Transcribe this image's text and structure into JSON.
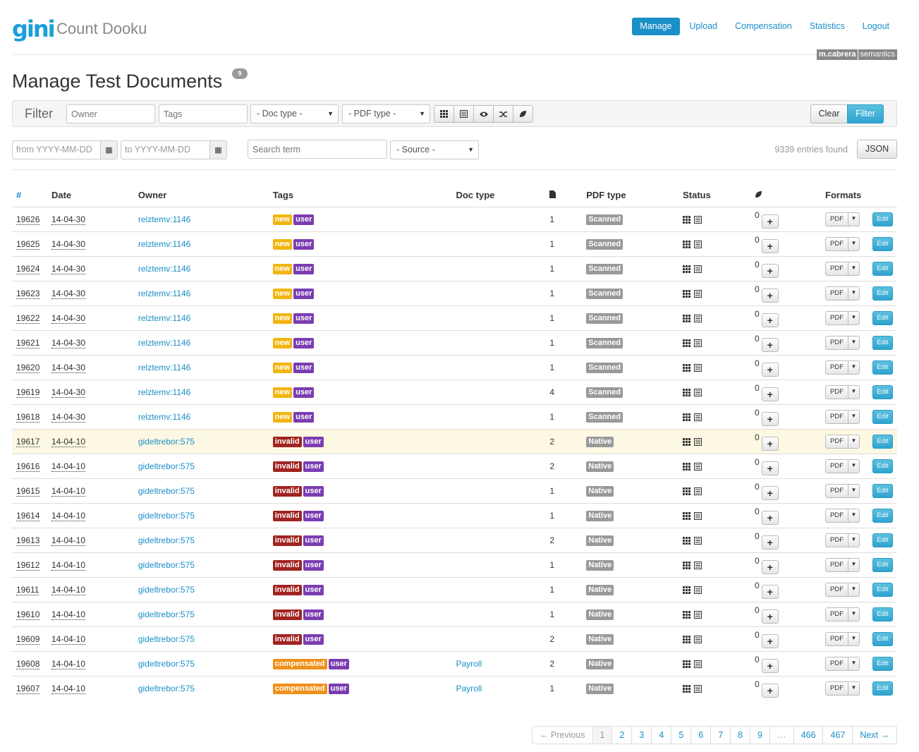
{
  "header": {
    "logo": "gini",
    "app_name": "Count Dooku",
    "nav": [
      "Manage",
      "Upload",
      "Compensation",
      "Statistics",
      "Logout"
    ],
    "user_badge": {
      "user": "m.cabrera",
      "org": "semantics"
    }
  },
  "page": {
    "title": "Manage Test Documents",
    "badge": "9"
  },
  "filter": {
    "label": "Filter",
    "owner_placeholder": "Owner",
    "tags_placeholder": "Tags",
    "doc_type": "- Doc type -",
    "pdf_type": "- PDF type -",
    "clear_label": "Clear",
    "filter_label": "Filter",
    "from_placeholder": "from YYYY-MM-DD",
    "to_placeholder": "to YYYY-MM-DD",
    "search_placeholder": "Search term",
    "source": "- Source -",
    "entries_found": "9339 entries found",
    "json_label": "JSON"
  },
  "table": {
    "headers": {
      "num": "#",
      "date": "Date",
      "owner": "Owner",
      "tags": "Tags",
      "doctype": "Doc type",
      "pdf_type": "PDF type",
      "status": "Status",
      "formats": "Formats"
    },
    "rows": [
      {
        "id": "19626",
        "date": "14-04-30",
        "owner": "relztemv:1146",
        "tags": [
          "new",
          "user"
        ],
        "doctype": "",
        "pages": "1",
        "pdf_type": "Scanned",
        "count": "0",
        "format": "PDF",
        "edit": "Edit",
        "warn": false
      },
      {
        "id": "19625",
        "date": "14-04-30",
        "owner": "relztemv:1146",
        "tags": [
          "new",
          "user"
        ],
        "doctype": "",
        "pages": "1",
        "pdf_type": "Scanned",
        "count": "0",
        "format": "PDF",
        "edit": "Edit",
        "warn": false
      },
      {
        "id": "19624",
        "date": "14-04-30",
        "owner": "relztemv:1146",
        "tags": [
          "new",
          "user"
        ],
        "doctype": "",
        "pages": "1",
        "pdf_type": "Scanned",
        "count": "0",
        "format": "PDF",
        "edit": "Edit",
        "warn": false
      },
      {
        "id": "19623",
        "date": "14-04-30",
        "owner": "relztemv:1146",
        "tags": [
          "new",
          "user"
        ],
        "doctype": "",
        "pages": "1",
        "pdf_type": "Scanned",
        "count": "0",
        "format": "PDF",
        "edit": "Edit",
        "warn": false
      },
      {
        "id": "19622",
        "date": "14-04-30",
        "owner": "relztemv:1146",
        "tags": [
          "new",
          "user"
        ],
        "doctype": "",
        "pages": "1",
        "pdf_type": "Scanned",
        "count": "0",
        "format": "PDF",
        "edit": "Edit",
        "warn": false
      },
      {
        "id": "19621",
        "date": "14-04-30",
        "owner": "relztemv:1146",
        "tags": [
          "new",
          "user"
        ],
        "doctype": "",
        "pages": "1",
        "pdf_type": "Scanned",
        "count": "0",
        "format": "PDF",
        "edit": "Edit",
        "warn": false
      },
      {
        "id": "19620",
        "date": "14-04-30",
        "owner": "relztemv:1146",
        "tags": [
          "new",
          "user"
        ],
        "doctype": "",
        "pages": "1",
        "pdf_type": "Scanned",
        "count": "0",
        "format": "PDF",
        "edit": "Edit",
        "warn": false
      },
      {
        "id": "19619",
        "date": "14-04-30",
        "owner": "relztemv:1146",
        "tags": [
          "new",
          "user"
        ],
        "doctype": "",
        "pages": "4",
        "pdf_type": "Scanned",
        "count": "0",
        "format": "PDF",
        "edit": "Edit",
        "warn": false
      },
      {
        "id": "19618",
        "date": "14-04-30",
        "owner": "relztemv:1146",
        "tags": [
          "new",
          "user"
        ],
        "doctype": "",
        "pages": "1",
        "pdf_type": "Scanned",
        "count": "0",
        "format": "PDF",
        "edit": "Edit",
        "warn": false
      },
      {
        "id": "19617",
        "date": "14-04-10",
        "owner": "gideltrebor:575",
        "tags": [
          "invalid",
          "user"
        ],
        "doctype": "",
        "pages": "2",
        "pdf_type": "Native",
        "count": "0",
        "format": "PDF",
        "edit": "Edit",
        "warn": true
      },
      {
        "id": "19616",
        "date": "14-04-10",
        "owner": "gideltrebor:575",
        "tags": [
          "invalid",
          "user"
        ],
        "doctype": "",
        "pages": "2",
        "pdf_type": "Native",
        "count": "0",
        "format": "PDF",
        "edit": "Edit",
        "warn": false
      },
      {
        "id": "19615",
        "date": "14-04-10",
        "owner": "gideltrebor:575",
        "tags": [
          "invalid",
          "user"
        ],
        "doctype": "",
        "pages": "1",
        "pdf_type": "Native",
        "count": "0",
        "format": "PDF",
        "edit": "Edit",
        "warn": false
      },
      {
        "id": "19614",
        "date": "14-04-10",
        "owner": "gideltrebor:575",
        "tags": [
          "invalid",
          "user"
        ],
        "doctype": "",
        "pages": "1",
        "pdf_type": "Native",
        "count": "0",
        "format": "PDF",
        "edit": "Edit",
        "warn": false
      },
      {
        "id": "19613",
        "date": "14-04-10",
        "owner": "gideltrebor:575",
        "tags": [
          "invalid",
          "user"
        ],
        "doctype": "",
        "pages": "2",
        "pdf_type": "Native",
        "count": "0",
        "format": "PDF",
        "edit": "Edit",
        "warn": false
      },
      {
        "id": "19612",
        "date": "14-04-10",
        "owner": "gideltrebor:575",
        "tags": [
          "invalid",
          "user"
        ],
        "doctype": "",
        "pages": "1",
        "pdf_type": "Native",
        "count": "0",
        "format": "PDF",
        "edit": "Edit",
        "warn": false
      },
      {
        "id": "19611",
        "date": "14-04-10",
        "owner": "gideltrebor:575",
        "tags": [
          "invalid",
          "user"
        ],
        "doctype": "",
        "pages": "1",
        "pdf_type": "Native",
        "count": "0",
        "format": "PDF",
        "edit": "Edit",
        "warn": false
      },
      {
        "id": "19610",
        "date": "14-04-10",
        "owner": "gideltrebor:575",
        "tags": [
          "invalid",
          "user"
        ],
        "doctype": "",
        "pages": "1",
        "pdf_type": "Native",
        "count": "0",
        "format": "PDF",
        "edit": "Edit",
        "warn": false
      },
      {
        "id": "19609",
        "date": "14-04-10",
        "owner": "gideltrebor:575",
        "tags": [
          "invalid",
          "user"
        ],
        "doctype": "",
        "pages": "2",
        "pdf_type": "Native",
        "count": "0",
        "format": "PDF",
        "edit": "Edit",
        "warn": false
      },
      {
        "id": "19608",
        "date": "14-04-10",
        "owner": "gideltrebor:575",
        "tags": [
          "compensated",
          "user"
        ],
        "doctype": "Payroll",
        "pages": "2",
        "pdf_type": "Native",
        "count": "0",
        "format": "PDF",
        "edit": "Edit",
        "warn": false
      },
      {
        "id": "19607",
        "date": "14-04-10",
        "owner": "gideltrebor:575",
        "tags": [
          "compensated",
          "user"
        ],
        "doctype": "Payroll",
        "pages": "1",
        "pdf_type": "Native",
        "count": "0",
        "format": "PDF",
        "edit": "Edit",
        "warn": false
      }
    ]
  },
  "pagination": {
    "previous": "← Previous",
    "pages": [
      "1",
      "2",
      "3",
      "4",
      "5",
      "6",
      "7",
      "8",
      "9",
      "…",
      "466",
      "467"
    ],
    "active": "1",
    "next": "Next →"
  },
  "colors": {
    "accent": "#1a8fc8",
    "tag_new": "#f2b510",
    "tag_user": "#7a3db1",
    "tag_invalid": "#a0231f",
    "tag_compensated": "#f0901a",
    "warn_row": "#fcf8e3"
  }
}
